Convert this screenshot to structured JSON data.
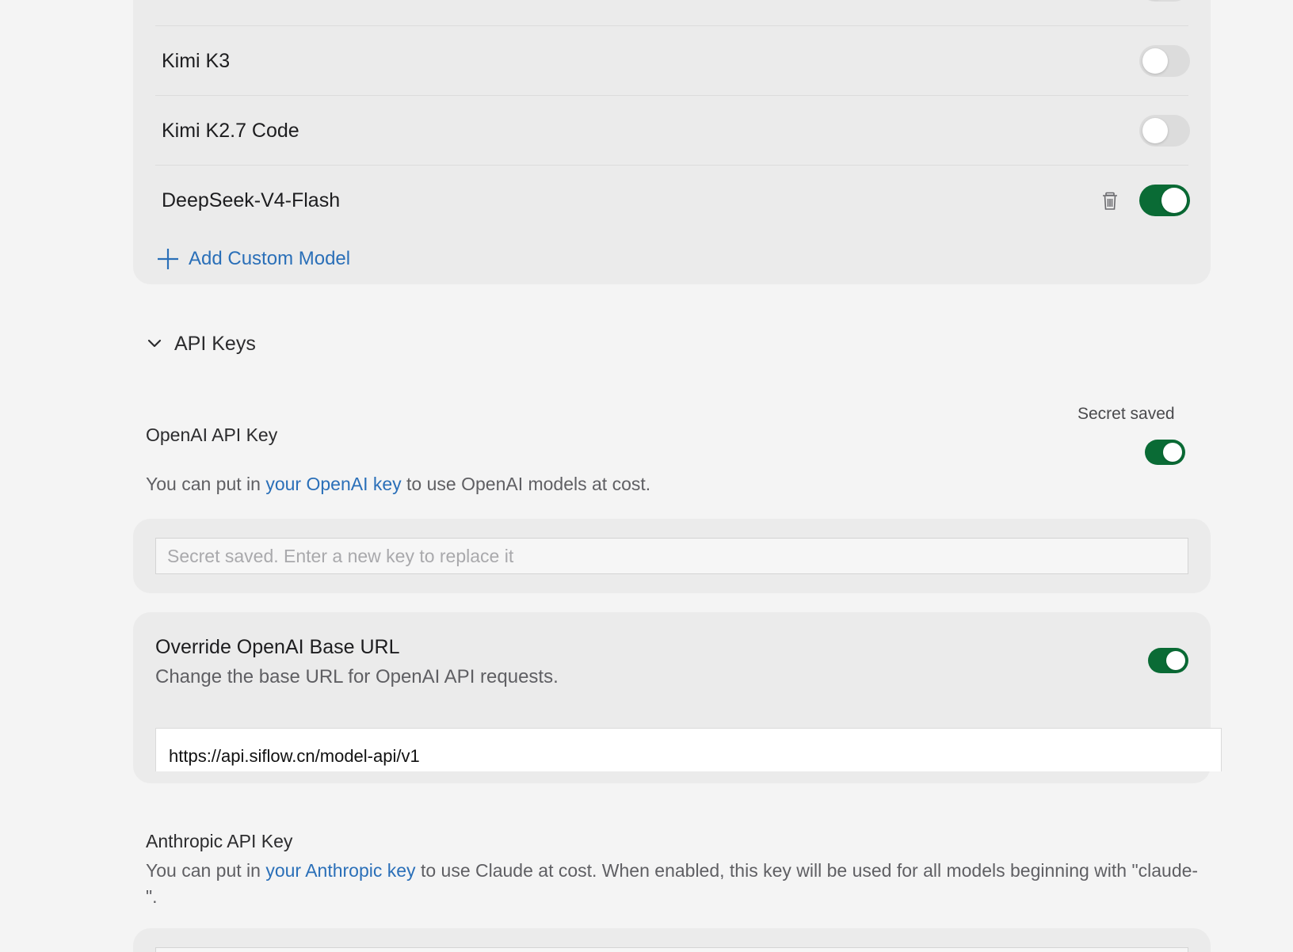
{
  "models": [
    {
      "name": "Kimi K3",
      "enabled": false,
      "deletable": false
    },
    {
      "name": "Kimi K2.7 Code",
      "enabled": false,
      "deletable": false
    },
    {
      "name": "DeepSeek-V4-Flash",
      "enabled": true,
      "deletable": true
    }
  ],
  "add_custom_model_label": "Add Custom Model",
  "api_keys": {
    "section_title": "API Keys",
    "openai": {
      "label": "OpenAI API Key",
      "status": "Secret saved",
      "enabled": true,
      "desc_before": "You can put in ",
      "desc_link": "your OpenAI key",
      "desc_after": " to use OpenAI models at cost.",
      "placeholder": "Secret saved. Enter a new key to replace it",
      "value": ""
    },
    "override": {
      "title": "Override OpenAI Base URL",
      "desc": "Change the base URL for OpenAI API requests.",
      "enabled": true,
      "url": "https://api.siflow.cn/model-api/v1"
    },
    "anthropic": {
      "label": "Anthropic API Key",
      "desc_before": "You can put in ",
      "desc_link": "your Anthropic key",
      "desc_after": " to use Claude at cost. When enabled, this key will be used for all models beginning with \"claude-\"."
    }
  },
  "colors": {
    "toggle_on": "#0a6b35",
    "toggle_off": "#dcdcdc",
    "link": "#2a6fb8"
  }
}
